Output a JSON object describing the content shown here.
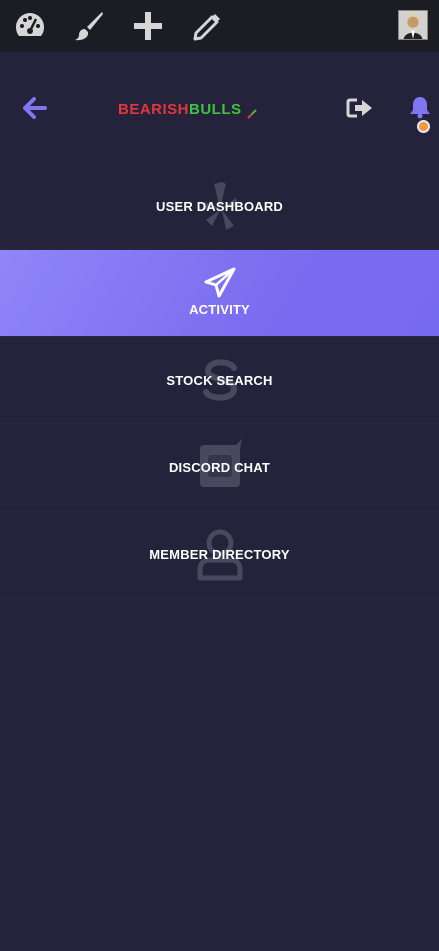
{
  "topbar": {
    "icons": [
      "dashboard-gauge-icon",
      "brush-icon",
      "plus-icon",
      "pencil-icon"
    ],
    "avatar": "user-avatar"
  },
  "header": {
    "back_icon": "arrow-left-icon",
    "logo": {
      "part1": "BEARISH",
      "part2": "BULLS",
      "mark": "chart-arrow-icon"
    },
    "logout_icon": "sign-out-icon",
    "bell_icon": "bell-icon",
    "colors": {
      "accent": "#7b6df0",
      "notif": "#f0983c",
      "bear": "#e0373c",
      "bull": "#3fc23e"
    }
  },
  "menu": {
    "items": [
      {
        "label": "USER DASHBOARD",
        "icon": "yelp-icon",
        "active": false
      },
      {
        "label": "ACTIVITY",
        "icon": "paper-plane-icon",
        "active": true
      },
      {
        "label": "STOCK SEARCH",
        "icon": "dollar-s-icon",
        "active": false
      },
      {
        "label": "DISCORD CHAT",
        "icon": "chat-bubble-icon",
        "active": false
      },
      {
        "label": "MEMBER DIRECTORY",
        "icon": "user-icon",
        "active": false
      }
    ]
  }
}
